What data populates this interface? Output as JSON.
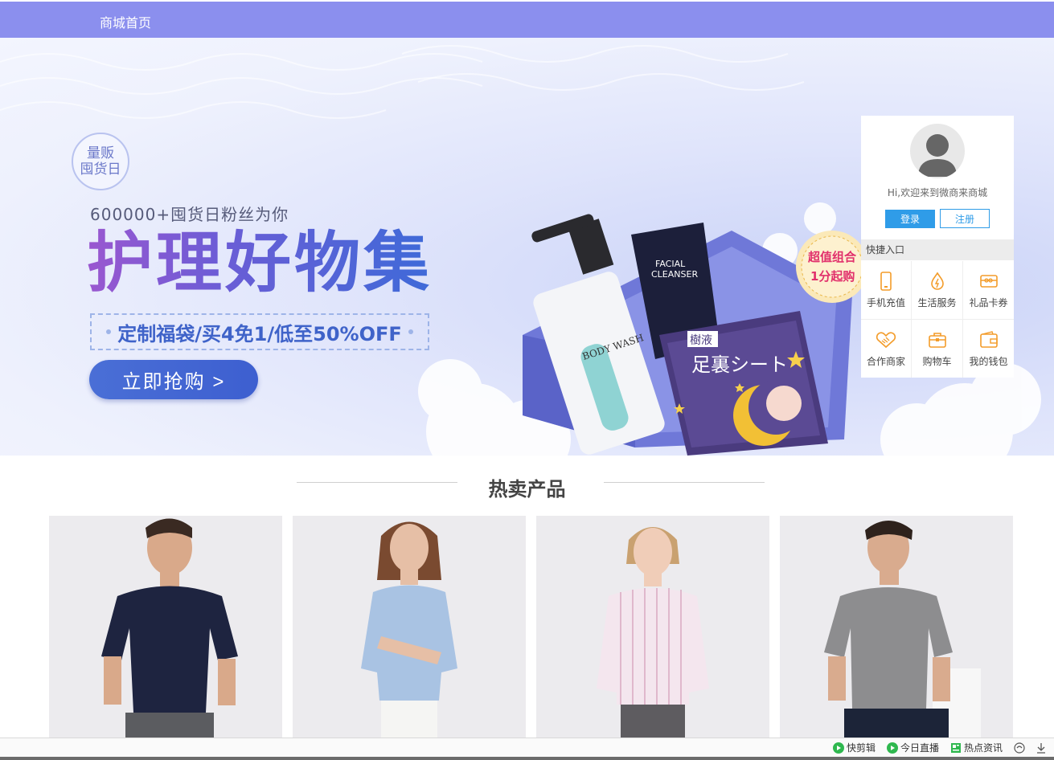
{
  "nav": {
    "home_label": "商城首页"
  },
  "banner": {
    "badge_line1": "量贩",
    "badge_line2": "囤货日",
    "fans_text": "600000+囤货日粉丝为你",
    "headline": "护理好物集",
    "promo_text": "定制福袋/买4免1/低至50%OFF",
    "cta_label": "立即抢购 >",
    "combo_tag_line1": "超值组合",
    "combo_tag_line2": "1分起购",
    "cleanser_label1": "FACIAL",
    "cleanser_label2": "CLEANSER",
    "bodywash_label": "BODY WASH",
    "box_title": "足裏シート",
    "box_badge": "樹液",
    "carousel_active_index": 0,
    "carousel_count": 2
  },
  "user_panel": {
    "welcome": "Hi,欢迎来到微商来商城",
    "login_label": "登录",
    "register_label": "注册",
    "quick_title": "快捷入口",
    "quick_items": [
      {
        "label": "手机充值",
        "icon": "phone-icon"
      },
      {
        "label": "生活服务",
        "icon": "flame-icon"
      },
      {
        "label": "礼品卡券",
        "icon": "gift-card-icon"
      },
      {
        "label": "合作商家",
        "icon": "handshake-icon"
      },
      {
        "label": "购物车",
        "icon": "cart-icon"
      },
      {
        "label": "我的钱包",
        "icon": "wallet-icon"
      }
    ],
    "accent_color": "#f39c2a"
  },
  "hot": {
    "title": "热卖产品",
    "products": [
      {
        "alt": "navy t-shirt model"
      },
      {
        "alt": "light blue knit top model"
      },
      {
        "alt": "striped shirt model"
      },
      {
        "alt": "grey t-shirt model"
      }
    ]
  },
  "statusbar": {
    "items": [
      {
        "label": "快剪辑",
        "icon": "play-icon"
      },
      {
        "label": "今日直播",
        "icon": "play-icon"
      },
      {
        "label": "热点资讯",
        "icon": "news-icon"
      }
    ]
  },
  "colors": {
    "nav_bg": "#8b8fee",
    "primary_blue": "#2f9ce8",
    "headline_start": "#9a57d0",
    "headline_end": "#3e6ad8"
  }
}
